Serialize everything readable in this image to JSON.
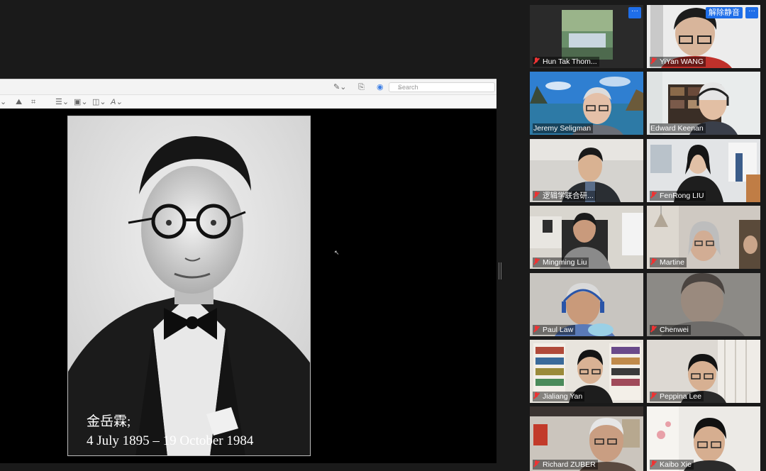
{
  "toolbar": {
    "search_placeholder": "Search"
  },
  "slide": {
    "caption_line1": "金岳霖;",
    "caption_line2": "4 July 1895 – 19 October 1984"
  },
  "gallery": {
    "unmute_label": "解除静音",
    "more_label": "···",
    "participants": [
      {
        "name": "Hun Tak Thom...",
        "muted": true
      },
      {
        "name": "YiYan WANG",
        "muted": true
      },
      {
        "name": "Jeremy Seligman",
        "muted": false,
        "active": true
      },
      {
        "name": "Edward Keenan",
        "muted": false
      },
      {
        "name": "逻辑学联合研...",
        "muted": true
      },
      {
        "name": "FenRong LIU",
        "muted": true
      },
      {
        "name": "Mingming Liu",
        "muted": true
      },
      {
        "name": "Martine",
        "muted": true
      },
      {
        "name": "Paul Law",
        "muted": true
      },
      {
        "name": "Chenwei",
        "muted": true
      },
      {
        "name": "Jialiang Yan",
        "muted": true
      },
      {
        "name": "Peppina Lee",
        "muted": true
      },
      {
        "name": "Richard ZUBER",
        "muted": true
      },
      {
        "name": "Kaibo Xie",
        "muted": true
      }
    ]
  },
  "colors": {
    "active_speaker": "#cde23a",
    "accent": "#1f6ee8",
    "muted_mic": "#e33333"
  }
}
